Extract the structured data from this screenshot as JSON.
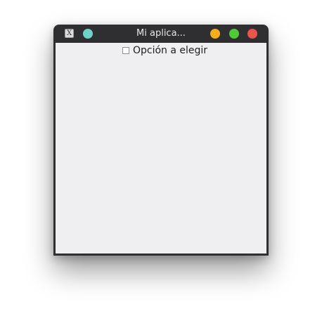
{
  "window": {
    "title": "Mi aplica...",
    "app_icon_glyph": "X",
    "buttons": {
      "left_dot_color": "#6fd1c7",
      "minimize_color": "#f4ad1e",
      "maximize_color": "#4ec93a",
      "close_color": "#e8554b"
    }
  },
  "content": {
    "checkbox": {
      "label": "Opción a elegir",
      "checked": false
    }
  }
}
